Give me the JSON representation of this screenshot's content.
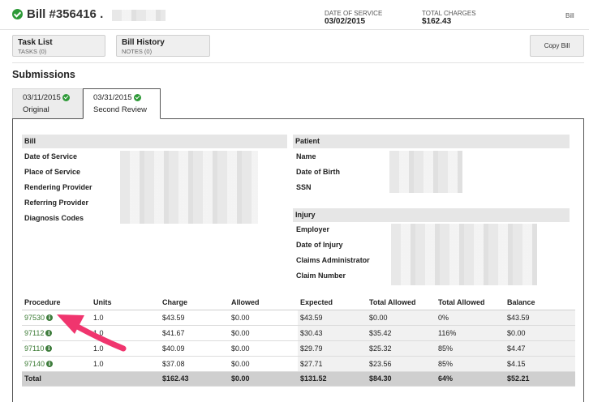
{
  "header": {
    "title": "Bill #356416",
    "title_suffix": ".",
    "date_of_service_label": "DATE OF SERVICE",
    "date_of_service_value": "03/02/2015",
    "total_charges_label": "TOTAL CHARGES",
    "total_charges_value": "$162.43",
    "right_label": "Bill"
  },
  "toolbar": {
    "task_list_label": "Task List",
    "task_list_sub": "TASKS (0)",
    "bill_history_label": "Bill History",
    "bill_history_sub": "NOTES (0)",
    "copy_bill_label": "Copy Bill"
  },
  "submissions": {
    "title": "Submissions",
    "tabs": [
      {
        "date": "03/11/2015",
        "name": "Original",
        "active": false
      },
      {
        "date": "03/31/2015",
        "name": "Second Review",
        "active": true
      }
    ]
  },
  "bill_section": {
    "header": "Bill",
    "fields": [
      "Date of Service",
      "Place of Service",
      "Rendering Provider",
      "Referring Provider",
      "Diagnosis Codes"
    ]
  },
  "patient_section": {
    "header": "Patient",
    "fields": [
      "Name",
      "Date of Birth",
      "SSN"
    ]
  },
  "injury_section": {
    "header": "Injury",
    "fields": [
      "Employer",
      "Date of Injury",
      "Claims Administrator",
      "Claim Number"
    ]
  },
  "procedures": {
    "columns": [
      "Procedure",
      "Units",
      "Charge",
      "Allowed",
      "Expected",
      "Total Allowed",
      "Total Allowed",
      "Balance"
    ],
    "rows": [
      {
        "code": "97530",
        "units": "1.0",
        "charge": "$43.59",
        "allowed": "$0.00",
        "expected": "$43.59",
        "total_allowed": "$0.00",
        "pct": "0%",
        "balance": "$43.59"
      },
      {
        "code": "97112",
        "units": "1.0",
        "charge": "$41.67",
        "allowed": "$0.00",
        "expected": "$30.43",
        "total_allowed": "$35.42",
        "pct": "116%",
        "balance": "$0.00"
      },
      {
        "code": "97110",
        "units": "1.0",
        "charge": "$40.09",
        "allowed": "$0.00",
        "expected": "$29.79",
        "total_allowed": "$25.32",
        "pct": "85%",
        "balance": "$4.47"
      },
      {
        "code": "97140",
        "units": "1.0",
        "charge": "$37.08",
        "allowed": "$0.00",
        "expected": "$27.71",
        "total_allowed": "$23.56",
        "pct": "85%",
        "balance": "$4.15"
      }
    ],
    "total": {
      "label": "Total",
      "units": "",
      "charge": "$162.43",
      "allowed": "$0.00",
      "expected": "$131.52",
      "total_allowed": "$84.30",
      "pct": "64%",
      "balance": "$52.21"
    }
  },
  "colors": {
    "check_green": "#2e9a38",
    "arrow_pink": "#f0356e",
    "code_link": "#3a7a33"
  }
}
